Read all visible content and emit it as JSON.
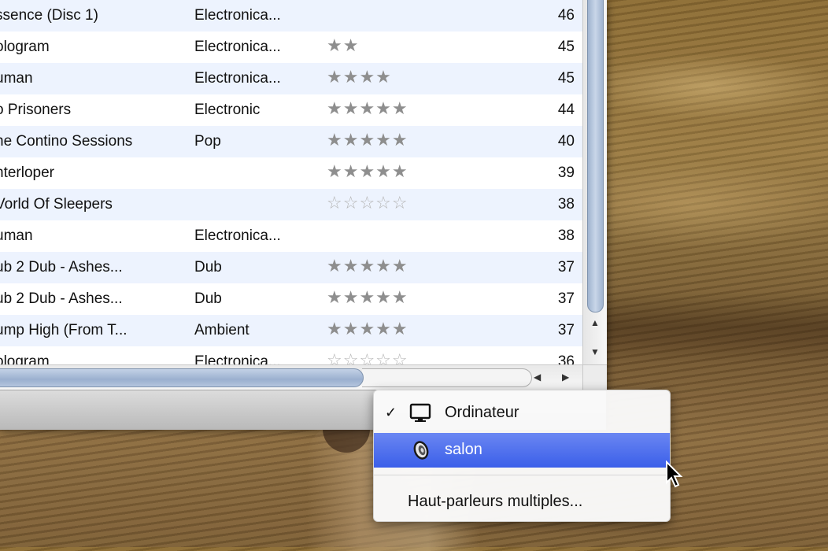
{
  "table": {
    "rows": [
      {
        "album": "ssence (Disc 1)",
        "genre": "Electronica...",
        "stars_full": "",
        "stars_empty": "",
        "plays": "46"
      },
      {
        "album": "ologram",
        "genre": "Electronica...",
        "stars_full": "★★",
        "stars_empty": "",
        "plays": "45"
      },
      {
        "album": "uman",
        "genre": "Electronica...",
        "stars_full": "★★★★",
        "stars_empty": "",
        "plays": "45"
      },
      {
        "album": "o Prisoners",
        "genre": "Electronic",
        "stars_full": "★★★★★",
        "stars_empty": "",
        "plays": "44"
      },
      {
        "album": "he Contino Sessions",
        "genre": "Pop",
        "stars_full": "★★★★★",
        "stars_empty": "",
        "plays": "40"
      },
      {
        "album": "nterloper",
        "genre": "",
        "stars_full": "★★★★★",
        "stars_empty": "",
        "plays": "39"
      },
      {
        "album": "Vorld Of Sleepers",
        "genre": "",
        "stars_full": "",
        "stars_empty": "☆☆☆☆☆",
        "plays": "38"
      },
      {
        "album": "uman",
        "genre": "Electronica...",
        "stars_full": "",
        "stars_empty": "",
        "plays": "38"
      },
      {
        "album": "ub 2 Dub - Ashes...",
        "genre": "Dub",
        "stars_full": "★★★★★",
        "stars_empty": "",
        "plays": "37"
      },
      {
        "album": "ub 2 Dub - Ashes...",
        "genre": "Dub",
        "stars_full": "★★★★★",
        "stars_empty": "",
        "plays": "37"
      },
      {
        "album": "ump High (From T...",
        "genre": "Ambient",
        "stars_full": "★★★★★",
        "stars_empty": "",
        "plays": "37"
      },
      {
        "album": "ologram",
        "genre": "Electronica...",
        "stars_full": "",
        "stars_empty": "☆☆☆☆☆",
        "plays": "36"
      }
    ]
  },
  "menu": {
    "items": [
      {
        "label": "Ordinateur",
        "checked": true,
        "icon": "monitor-icon"
      },
      {
        "label": "salon",
        "checked": false,
        "icon": "speaker-icon",
        "highlighted": true
      },
      {
        "label": "Haut-parleurs multiples...",
        "checked": false
      }
    ],
    "check_glyph": "✓"
  },
  "colors": {
    "highlight": "#3b5fe9",
    "row_alt": "#edf3fe",
    "star": "#8e8e8e"
  }
}
